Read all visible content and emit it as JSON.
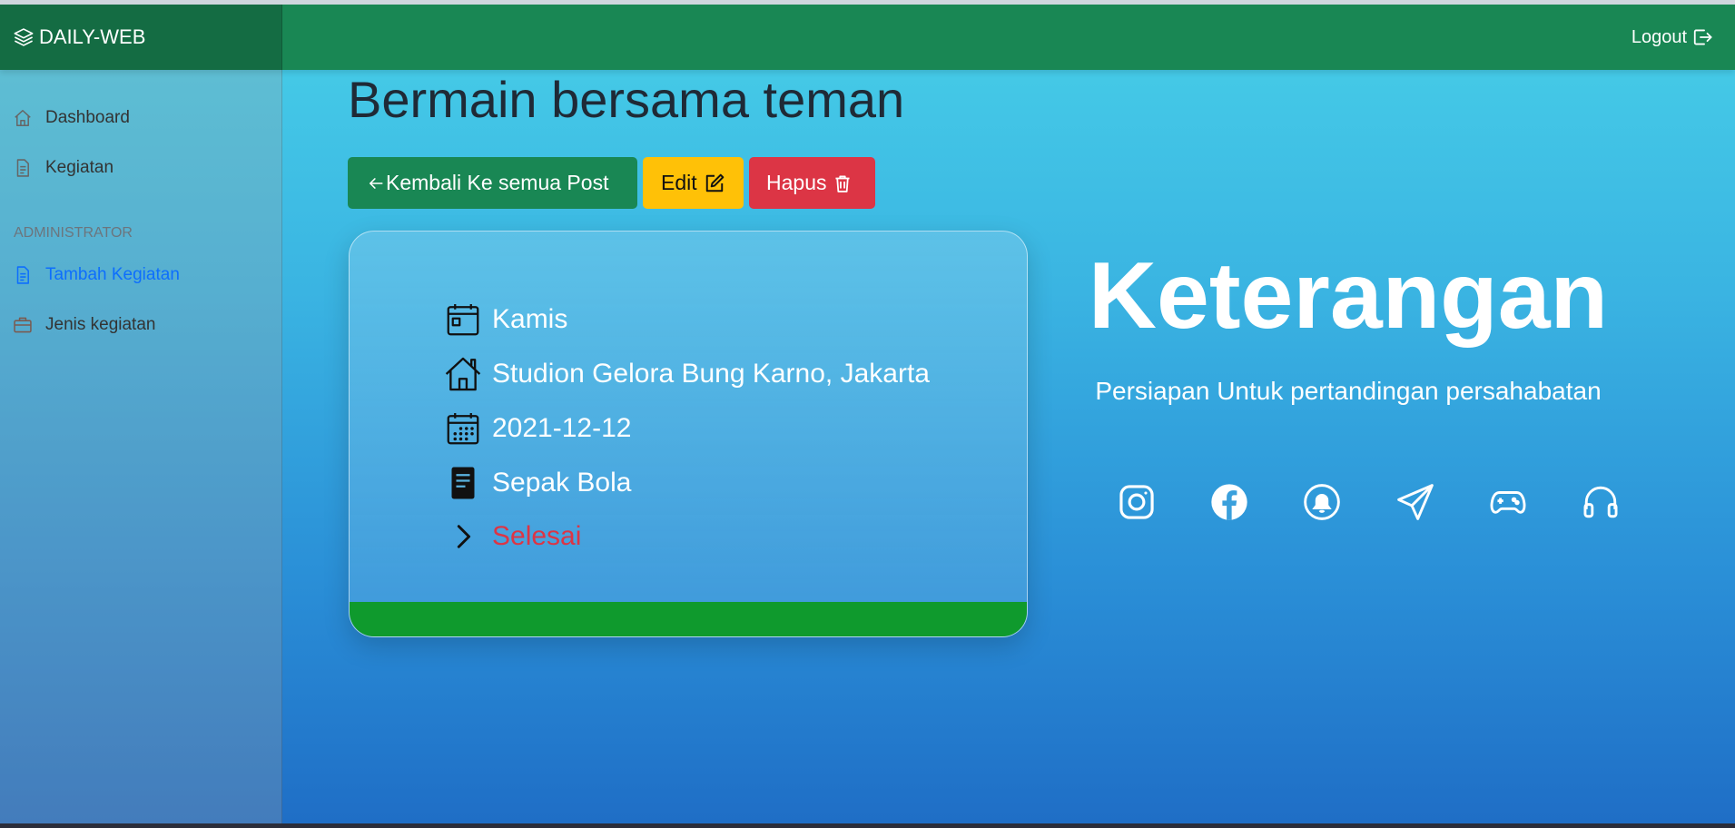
{
  "navbar": {
    "brand": "DAILY-WEB",
    "brand_icon": "layers-icon",
    "logout_label": "Logout",
    "logout_icon": "box-arrow-right-icon"
  },
  "sidebar": {
    "items": [
      {
        "label": "Dashboard",
        "icon": "house-icon",
        "active": false
      },
      {
        "label": "Kegiatan",
        "icon": "file-text-icon",
        "active": false
      }
    ],
    "admin_heading": "ADMINISTRATOR",
    "admin_items": [
      {
        "label": "Tambah Kegiatan",
        "icon": "file-text-icon",
        "active": true
      },
      {
        "label": "Jenis kegiatan",
        "icon": "briefcase-icon",
        "active": false
      }
    ]
  },
  "main": {
    "title": "Bermain bersama teman",
    "buttons": {
      "back_label": "Kembali Ke semua Post",
      "edit_label": "Edit",
      "delete_label": "Hapus"
    },
    "card": {
      "day": "Kamis",
      "location": "Studion Gelora Bung Karno, Jakarta",
      "date": "2021-12-12",
      "category": "Sepak Bola",
      "status": "Selesai"
    },
    "info": {
      "heading": "Keterangan",
      "description": "Persiapan Untuk pertandingan persahabatan"
    },
    "social_icons": [
      "instagram-icon",
      "facebook-icon",
      "bell-icon",
      "send-icon",
      "controller-icon",
      "headphones-icon"
    ]
  },
  "colors": {
    "navbar": "#198754",
    "brand_bg": "#146c43",
    "edit": "#ffc107",
    "delete": "#dc3545",
    "card_footer": "#0f9a2d",
    "active_link": "#0d6efd",
    "status": "#dc3545"
  }
}
